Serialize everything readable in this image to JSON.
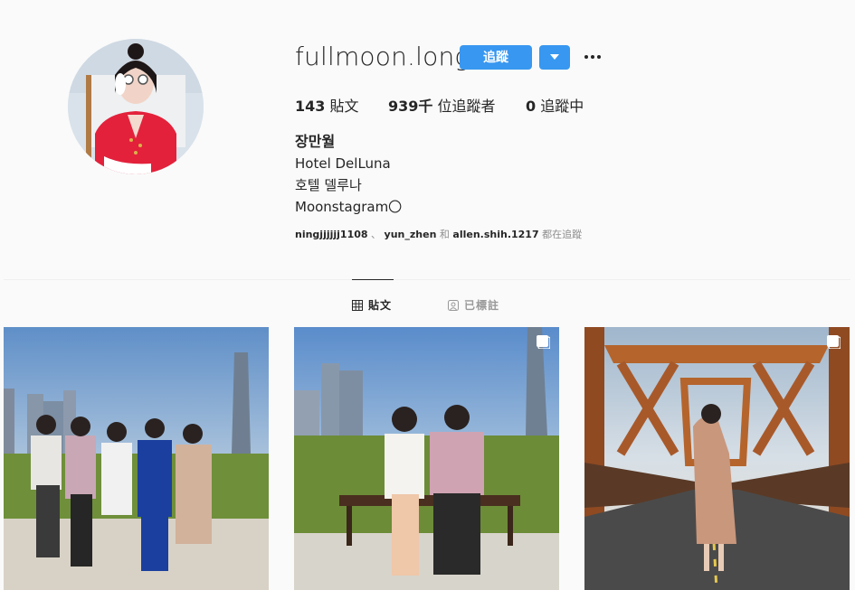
{
  "profile": {
    "username": "fullmoon.long",
    "follow_label": "追蹤",
    "stats": {
      "posts_count": "143",
      "posts_label": "貼文",
      "followers_count": "939千",
      "followers_label": "位追蹤者",
      "following_count": "0",
      "following_label": "追蹤中"
    },
    "bio": {
      "name": "장만월",
      "line1": "Hotel DelLuna",
      "line2": "호텔 델루나",
      "line3": "Moonstagram〇"
    },
    "followed_by": {
      "user1": "ningjjjjjj1108",
      "sep1": "、",
      "user2": "yun_zhen",
      "and": "和",
      "user3": "allen.shih.1217",
      "suffix": "都在追蹤"
    }
  },
  "tabs": {
    "posts_label": "貼文",
    "tagged_label": "已標註"
  },
  "posts": [
    {
      "name": "group-sunset-bench",
      "multi": false
    },
    {
      "name": "couple-on-bench",
      "multi": true
    },
    {
      "name": "woman-on-bridge",
      "multi": true
    }
  ],
  "colors": {
    "accent": "#3897f0",
    "text": "#262626",
    "muted": "#8e8e8e",
    "background": "#fafafa"
  },
  "icons": [
    "dropdown-caret-icon",
    "more-options-icon",
    "grid-icon",
    "tagged-icon",
    "multiple-photos-icon"
  ]
}
